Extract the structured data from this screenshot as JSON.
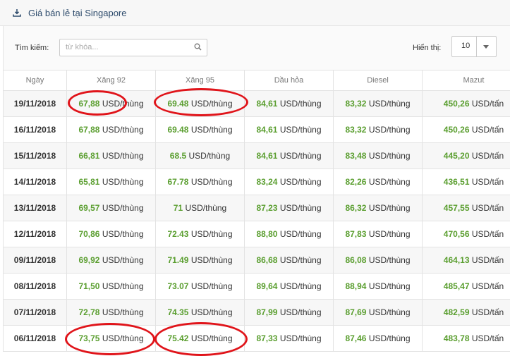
{
  "header": {
    "title": "Giá bán lẻ tại Singapore",
    "icon": "download-icon"
  },
  "toolbar": {
    "search_label": "Tìm kiếm:",
    "search_placeholder": "từ khóa...",
    "search_value": "",
    "show_label": "Hiển thị:",
    "page_size": "10"
  },
  "table": {
    "columns": [
      "Ngày",
      "Xăng 92",
      "Xăng 95",
      "Dầu hỏa",
      "Diesel",
      "Mazut"
    ],
    "rows": [
      [
        "19/11/2018",
        [
          "67,88",
          "USD/thùng"
        ],
        [
          "69.48",
          "USD/thùng"
        ],
        [
          "84,61",
          "USD/thùng"
        ],
        [
          "83,32",
          "USD/thùng"
        ],
        [
          "450,26",
          "USD/tấn"
        ]
      ],
      [
        "16/11/2018",
        [
          "67,88",
          "USD/thùng"
        ],
        [
          "69.48",
          "USD/thùng"
        ],
        [
          "84,61",
          "USD/thùng"
        ],
        [
          "83,32",
          "USD/thùng"
        ],
        [
          "450,26",
          "USD/tấn"
        ]
      ],
      [
        "15/11/2018",
        [
          "66,81",
          "USD/thùng"
        ],
        [
          "68.5",
          "USD/thùng"
        ],
        [
          "84,61",
          "USD/thùng"
        ],
        [
          "83,48",
          "USD/thùng"
        ],
        [
          "445,20",
          "USD/tấn"
        ]
      ],
      [
        "14/11/2018",
        [
          "65,81",
          "USD/thùng"
        ],
        [
          "67.78",
          "USD/thùng"
        ],
        [
          "83,24",
          "USD/thùng"
        ],
        [
          "82,26",
          "USD/thùng"
        ],
        [
          "436,51",
          "USD/tấn"
        ]
      ],
      [
        "13/11/2018",
        [
          "69,57",
          "USD/thùng"
        ],
        [
          "71",
          "USD/thùng"
        ],
        [
          "87,23",
          "USD/thùng"
        ],
        [
          "86,32",
          "USD/thùng"
        ],
        [
          "457,55",
          "USD/tấn"
        ]
      ],
      [
        "12/11/2018",
        [
          "70,86",
          "USD/thùng"
        ],
        [
          "72.43",
          "USD/thùng"
        ],
        [
          "88,80",
          "USD/thùng"
        ],
        [
          "87,83",
          "USD/thùng"
        ],
        [
          "470,56",
          "USD/tấn"
        ]
      ],
      [
        "09/11/2018",
        [
          "69,92",
          "USD/thùng"
        ],
        [
          "71.49",
          "USD/thùng"
        ],
        [
          "86,68",
          "USD/thùng"
        ],
        [
          "86,08",
          "USD/thùng"
        ],
        [
          "464,13",
          "USD/tấn"
        ]
      ],
      [
        "08/11/2018",
        [
          "71,50",
          "USD/thùng"
        ],
        [
          "73.07",
          "USD/thùng"
        ],
        [
          "89,64",
          "USD/thùng"
        ],
        [
          "88,94",
          "USD/thùng"
        ],
        [
          "485,47",
          "USD/tấn"
        ]
      ],
      [
        "07/11/2018",
        [
          "72,78",
          "USD/thùng"
        ],
        [
          "74.35",
          "USD/thùng"
        ],
        [
          "87,99",
          "USD/thùng"
        ],
        [
          "87,69",
          "USD/thùng"
        ],
        [
          "482,59",
          "USD/tấn"
        ]
      ],
      [
        "06/11/2018",
        [
          "73,75",
          "USD/thùng"
        ],
        [
          "75.42",
          "USD/thùng"
        ],
        [
          "87,33",
          "USD/thùng"
        ],
        [
          "87,46",
          "USD/thùng"
        ],
        [
          "483,78",
          "USD/tấn"
        ]
      ]
    ]
  },
  "colors": {
    "number": "#5a9e2f",
    "highlight": "#e0141a",
    "title": "#2c4a6b"
  }
}
